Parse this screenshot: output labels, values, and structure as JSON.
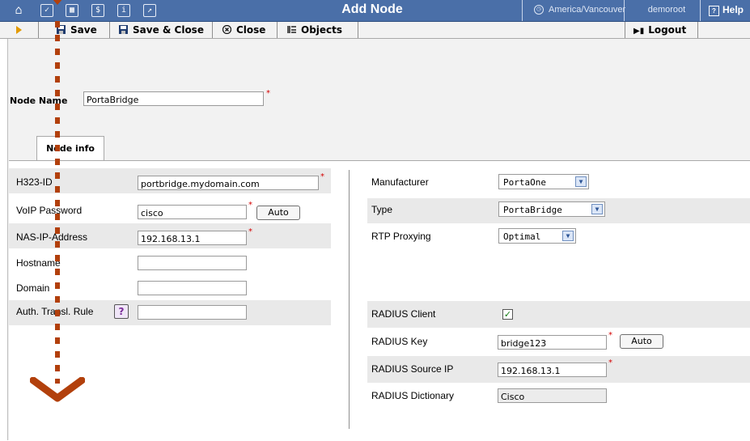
{
  "header": {
    "title": "Add Node",
    "timezone": "America/Vancouver",
    "user": "demoroot",
    "help": "Help",
    "nav_icons": [
      "home-icon",
      "checkbox-icon",
      "grid-icon",
      "dollar-icon",
      "info-icon",
      "chart-icon"
    ]
  },
  "toolbar": {
    "save": "Save",
    "save_close": "Save & Close",
    "close": "Close",
    "objects": "Objects",
    "logout": "Logout"
  },
  "node": {
    "name_label": "Node Name",
    "name_value": "PortaBridge"
  },
  "tabs": {
    "node_info": "Node info"
  },
  "left": {
    "h323_label": "H323-ID",
    "h323_value": "portbridge.mydomain.com",
    "voip_label": "VoIP Password",
    "voip_value": "cisco",
    "auto": "Auto",
    "nas_label": "NAS-IP-Address",
    "nas_value": "192.168.13.1",
    "hostname_label": "Hostname",
    "hostname_value": "",
    "domain_label": "Domain",
    "domain_value": "",
    "rule_label": "Auth. Transl. Rule",
    "rule_value": ""
  },
  "right": {
    "manufacturer_label": "Manufacturer",
    "manufacturer_value": "PortaOne",
    "type_label": "Type",
    "type_value": "PortaBridge",
    "rtp_label": "RTP Proxying",
    "rtp_value": "Optimal",
    "radius_client_label": "RADIUS Client",
    "radius_client_checked": true,
    "radius_key_label": "RADIUS Key",
    "radius_key_value": "bridge123",
    "auto": "Auto",
    "radius_ip_label": "RADIUS Source IP",
    "radius_ip_value": "192.168.13.1",
    "radius_dict_label": "RADIUS Dictionary",
    "radius_dict_value": "Cisco"
  },
  "colors": {
    "header": "#4a6fa8",
    "arrow": "#b2400c",
    "required": "#d40000"
  }
}
